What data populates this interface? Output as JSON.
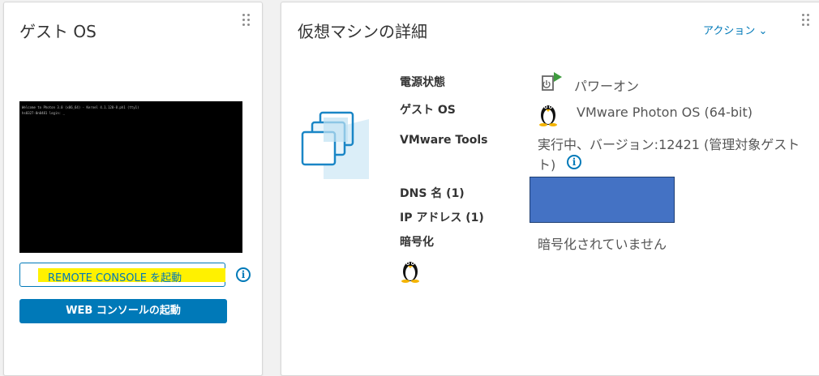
{
  "guest_os_card": {
    "title": "ゲスト OS",
    "console_lines": [
      "Welcome to Photon 3.0 (x86_64) - Kernel 4.1.120-8.ph1 (tty1)",
      "hs0327-0n0481 login: _"
    ],
    "remote_console_label": "REMOTE CONSOLE を起動",
    "web_console_label": "WEB コンソールの起動",
    "info_glyph": "i"
  },
  "vm_details_card": {
    "title": "仮想マシンの詳細",
    "actions_label": "アクション",
    "actions_chevron": "⌄",
    "rows": [
      {
        "label": "電源状態",
        "value": "パワーオン"
      },
      {
        "label": "ゲスト OS",
        "value": "VMware Photon OS (64-bit)"
      },
      {
        "label": "VMware Tools",
        "value_line1": "実行中、バージョン:12421 (管理対象ゲスト",
        "value_line2": "ト)"
      },
      {
        "label": "DNS 名 (1)"
      },
      {
        "label": "IP アドレス (1)"
      },
      {
        "label": "暗号化",
        "value": "暗号化されていません"
      }
    ],
    "icons": {
      "power": "power-on-icon",
      "os": "linux-tux-icon",
      "vm": "virtual-machine-icon"
    },
    "accent_color": "#0079b8",
    "redaction_color": "#4472c4"
  }
}
